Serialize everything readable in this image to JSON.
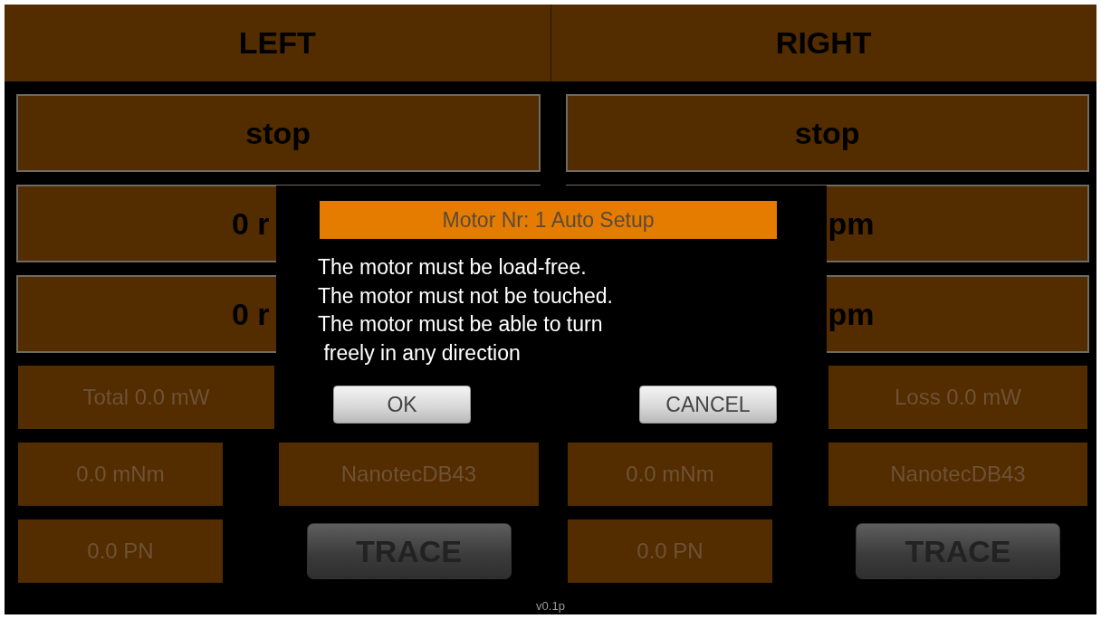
{
  "header": [
    {
      "label": "LEFT"
    },
    {
      "label": "RIGHT"
    }
  ],
  "sides": [
    {
      "kind": "left",
      "state_button": "stop",
      "speed_1": "0 r",
      "speed_2": "0 r",
      "power": "Total 0.0 mW",
      "torque": "0.0 mNm",
      "motor": "NanotecDB43",
      "pn": "0.0 PN",
      "trace_button": "TRACE"
    },
    {
      "kind": "right",
      "state_button": "stop",
      "speed_1": "pm",
      "speed_2": "pm",
      "power": "Loss 0.0 mW",
      "torque": "0.0 mNm",
      "motor": "NanotecDB43",
      "pn": "0.0 PN",
      "trace_button": "TRACE"
    }
  ],
  "dialog": {
    "title": "Motor Nr: 1 Auto Setup",
    "message_lines": [
      "The motor must be load-free.",
      "The motor must not be touched.",
      "The motor must be able to turn",
      " freely in any direction"
    ],
    "buttons": [
      "OK",
      "CANCEL"
    ]
  },
  "version": "v0.1p"
}
